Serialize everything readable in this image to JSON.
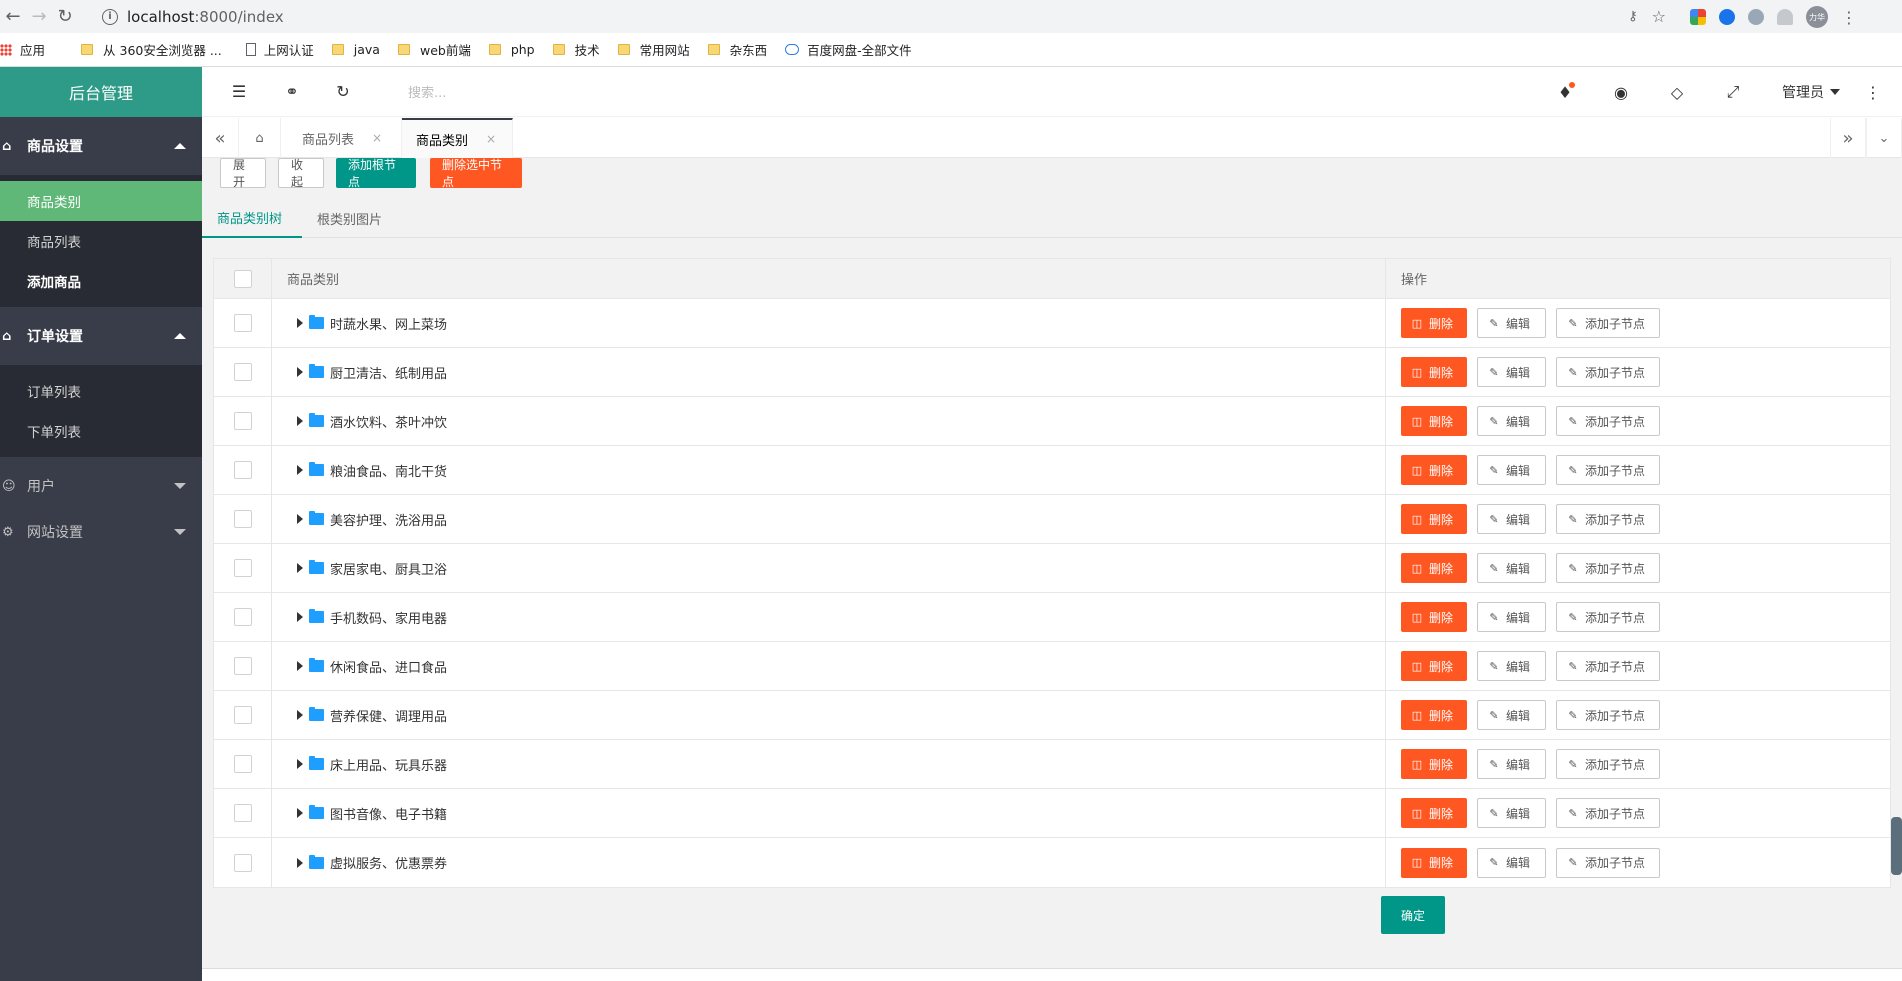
{
  "browser": {
    "url_host": "localhost",
    "url_path": ":8000/index",
    "avatar_text": "力华",
    "bookmarks": [
      "应用",
      "从 360安全浏览器 ...",
      "上网认证",
      "java",
      "web前端",
      "php",
      "技术",
      "常用网站",
      "杂东西",
      "百度网盘-全部文件"
    ]
  },
  "sidebar": {
    "logo": "后台管理",
    "groups": [
      {
        "title": "商品设置",
        "items": [
          "商品类别",
          "商品列表",
          "添加商品"
        ]
      },
      {
        "title": "订单设置",
        "items": [
          "订单列表",
          "下单列表"
        ]
      },
      {
        "title": "用户"
      },
      {
        "title": "网站设置"
      }
    ]
  },
  "header": {
    "search_placeholder": "搜索...",
    "admin": "管理员"
  },
  "tabs": {
    "items": [
      "商品列表",
      "商品类别"
    ],
    "close": "×"
  },
  "toolbar": {
    "expand": "展开",
    "collapse": "收起",
    "add_root": "添加根节点",
    "delete_selected": "删除选中节点"
  },
  "subtabs": [
    "商品类别树",
    "根类别图片"
  ],
  "table": {
    "headers": [
      "商品类别",
      "操作"
    ],
    "rows": [
      "时蔬水果、网上菜场",
      "厨卫清洁、纸制用品",
      "酒水饮料、茶叶冲饮",
      "粮油食品、南北干货",
      "美容护理、洗浴用品",
      "家居家电、厨具卫浴",
      "手机数码、家用电器",
      "休闲食品、进口食品",
      "营养保健、调理用品",
      "床上用品、玩具乐器",
      "图书音像、电子书籍",
      "虚拟服务、优惠票券"
    ],
    "actions": {
      "delete": "删除",
      "edit": "编辑",
      "add_child": "添加子节点"
    }
  },
  "confirm": "确定",
  "colors": {
    "primary": "#009688",
    "danger": "#ff5722",
    "sidebar": "#393d49",
    "active_menu": "#5fb878",
    "folder": "#1e9fff"
  }
}
